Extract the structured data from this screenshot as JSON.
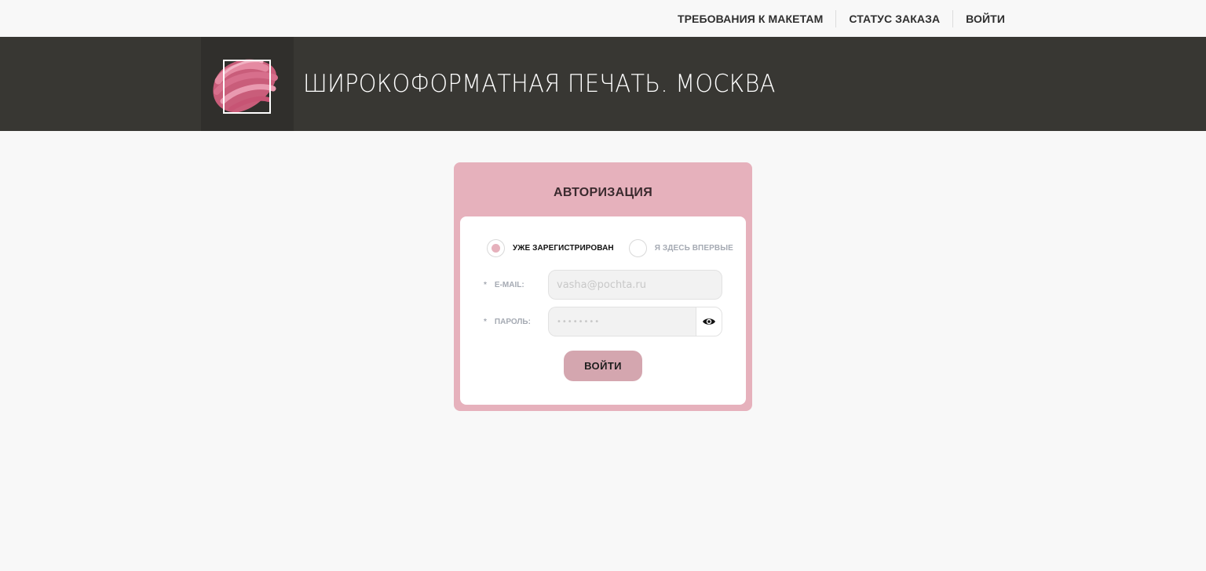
{
  "topnav": {
    "items": [
      {
        "label": "ТРЕБОВАНИЯ К МАКЕТАМ"
      },
      {
        "label": "СТАТУС ЗАКАЗА"
      },
      {
        "label": "ВОЙТИ"
      }
    ]
  },
  "header": {
    "title": "ШИРОКОФОРМАТНАЯ ПЕЧАТЬ. МОСКВА",
    "logo_icon": "paint-stroke-logo-icon"
  },
  "auth": {
    "title": "АВТОРИЗАЦИЯ",
    "options": [
      {
        "label": "УЖЕ ЗАРЕГИСТРИРОВАН",
        "selected": true
      },
      {
        "label": "Я ЗДЕСЬ ВПЕРВЫЕ",
        "selected": false
      }
    ],
    "email": {
      "required_mark": "*",
      "label": "E-MAIL:",
      "placeholder": "vasha@pochta.ru",
      "value": ""
    },
    "password": {
      "required_mark": "*",
      "label": "ПАРОЛЬ:",
      "placeholder": "••••••••",
      "value": "",
      "toggle_icon": "eye-icon"
    },
    "submit_label": "ВОЙТИ"
  },
  "colors": {
    "header_bg": "#383733",
    "card_bg": "#e6b1bc",
    "button_bg": "#d4a6af",
    "page_bg": "#f8f8f8"
  }
}
